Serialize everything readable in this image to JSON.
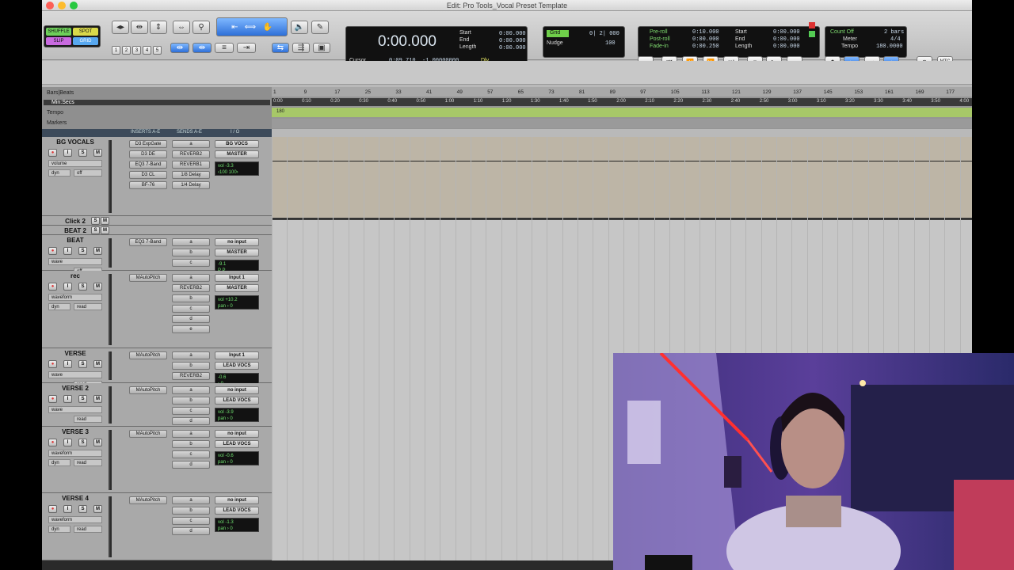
{
  "window": {
    "title": "Edit: Pro Tools_Vocal Preset Template"
  },
  "modes": {
    "shuffle": "SHUFFLE",
    "spot": "SPOT",
    "slip": "SLIP",
    "grid": "GRID"
  },
  "zoom_presets": [
    "1",
    "2",
    "3",
    "4",
    "5"
  ],
  "counter": {
    "main": "0:00.000",
    "start_label": "Start",
    "start": "0:00.000",
    "end_label": "End",
    "end": "0:00.000",
    "length_label": "Length",
    "length": "0:00.000",
    "cursor_label": "Cursor",
    "cursor": "0:09.710",
    "cursor_value": "-1.00000000",
    "dly": "Dly"
  },
  "grid": {
    "grid_label": "Grid",
    "grid_value": "0| 2| 000",
    "nudge_label": "Nudge",
    "nudge_value": "100"
  },
  "transport": {
    "preroll_label": "Pre-roll",
    "preroll": "0:10.000",
    "postroll_label": "Post-roll",
    "postroll": "0:00.000",
    "fadein_label": "Fade-in",
    "fadein": "0:00.250",
    "start_label": "Start",
    "start": "0:00.000",
    "end_label": "End",
    "end": "0:00.000",
    "length_label": "Length",
    "length": "0:00.000"
  },
  "tempo": {
    "count_off_label": "Count Off",
    "count_off": "2 bars",
    "meter_label": "Meter",
    "meter": "4/4",
    "tempo_label": "Tempo",
    "tempo": "180.0000"
  },
  "mtc": "MTC",
  "rulers": {
    "bars_label": "Bars|Beats",
    "min_label": "Min:Secs",
    "tempo_label": "Tempo",
    "markers_label": "Markers",
    "tempo_value": "180"
  },
  "bar_ticks": [
    "1",
    "9",
    "17",
    "25",
    "33",
    "41",
    "49",
    "57",
    "65",
    "73",
    "81",
    "89",
    "97",
    "105",
    "113",
    "121",
    "129",
    "137",
    "145",
    "153",
    "161",
    "169",
    "177"
  ],
  "min_ticks": [
    "0:00",
    "0:10",
    "0:20",
    "0:30",
    "0:40",
    "0:50",
    "1:00",
    "1:10",
    "1:20",
    "1:30",
    "1:40",
    "1:50",
    "2:00",
    "2:10",
    "2:20",
    "2:30",
    "2:40",
    "2:50",
    "3:00",
    "3:10",
    "3:20",
    "3:30",
    "3:40",
    "3:50",
    "4:00"
  ],
  "columns": {
    "inserts": "INSERTS A-E",
    "sends": "SENDS A-E",
    "io": "I / O"
  },
  "tracks": [
    {
      "name": "BG VOCALS",
      "view": "volume",
      "auto": "off",
      "dyn": "dyn",
      "inserts": [
        "D3 ExpGate",
        "D3 DE",
        "EQ3 7-Band",
        "D3 CL",
        "BF-76"
      ],
      "sends": [
        "a",
        "REVERB2",
        "REVERB1",
        "1/8 Delay",
        "1/4 Delay"
      ],
      "io_in": "BG VOCS",
      "io_out": "MASTER",
      "vol_label": "vol",
      "vol": "-3.3",
      "pan": "‹100   100›"
    },
    {
      "name": "Click 2"
    },
    {
      "name": "BEAT 2"
    },
    {
      "name": "BEAT",
      "view": "wave",
      "auto": "off",
      "inserts": [
        "EQ3 7-Band"
      ],
      "sends": [
        "a",
        "b",
        "c"
      ],
      "io_in": "no input",
      "io_out": "MASTER",
      "vol": "-9.1",
      "pan": "P  P"
    },
    {
      "name": "rec",
      "view": "waveform",
      "auto": "read",
      "dyn": "dyn",
      "inserts": [
        "MAutoPitch"
      ],
      "sends": [
        "a",
        "REVERB2",
        "b",
        "c",
        "d",
        "e"
      ],
      "io_in": "Input 1",
      "io_out": "MASTER",
      "vol_label": "vol",
      "vol": "+10.2",
      "pan_label": "pan",
      "pan": "› 0"
    },
    {
      "name": "VERSE",
      "view": "wave",
      "auto": "read",
      "inserts": [
        "MAutoPitch"
      ],
      "sends": [
        "a",
        "b",
        "REVERB2"
      ],
      "io_in": "Input 1",
      "io_out": "LEAD VOCS",
      "vol": "-0.6",
      "pan": "› 0"
    },
    {
      "name": "VERSE 2",
      "view": "wave",
      "auto": "read",
      "inserts": [
        "MAutoPitch"
      ],
      "sends": [
        "a",
        "b",
        "c",
        "d"
      ],
      "io_in": "no input",
      "io_out": "LEAD VOCS",
      "vol_label": "vol",
      "vol": "-3.9",
      "pan_label": "pan",
      "pan": "› 0"
    },
    {
      "name": "VERSE 3",
      "view": "waveform",
      "auto": "read",
      "dyn": "dyn",
      "inserts": [
        "MAutoPitch"
      ],
      "sends": [
        "a",
        "b",
        "c",
        "d"
      ],
      "io_in": "no input",
      "io_out": "LEAD VOCS",
      "vol_label": "vol",
      "vol": "-0.6",
      "pan_label": "pan",
      "pan": "› 0"
    },
    {
      "name": "VERSE 4",
      "view": "waveform",
      "auto": "read",
      "dyn": "dyn",
      "inserts": [
        "MAutoPitch"
      ],
      "sends": [
        "a",
        "b",
        "c",
        "d"
      ],
      "io_in": "no input",
      "io_out": "LEAD VOCS",
      "vol_label": "vol",
      "vol": "-1.3",
      "pan_label": "pan",
      "pan": "› 0"
    }
  ],
  "buttons": {
    "rec": "●",
    "input": "I",
    "solo": "S",
    "mute": "M",
    "solo_short": "S",
    "mute_short": "M"
  },
  "colors": {
    "accent_blue": "#3a7ee6",
    "tempo_green": "#a7c868",
    "meter_green": "#6fe06f",
    "rec_red": "#d33"
  }
}
